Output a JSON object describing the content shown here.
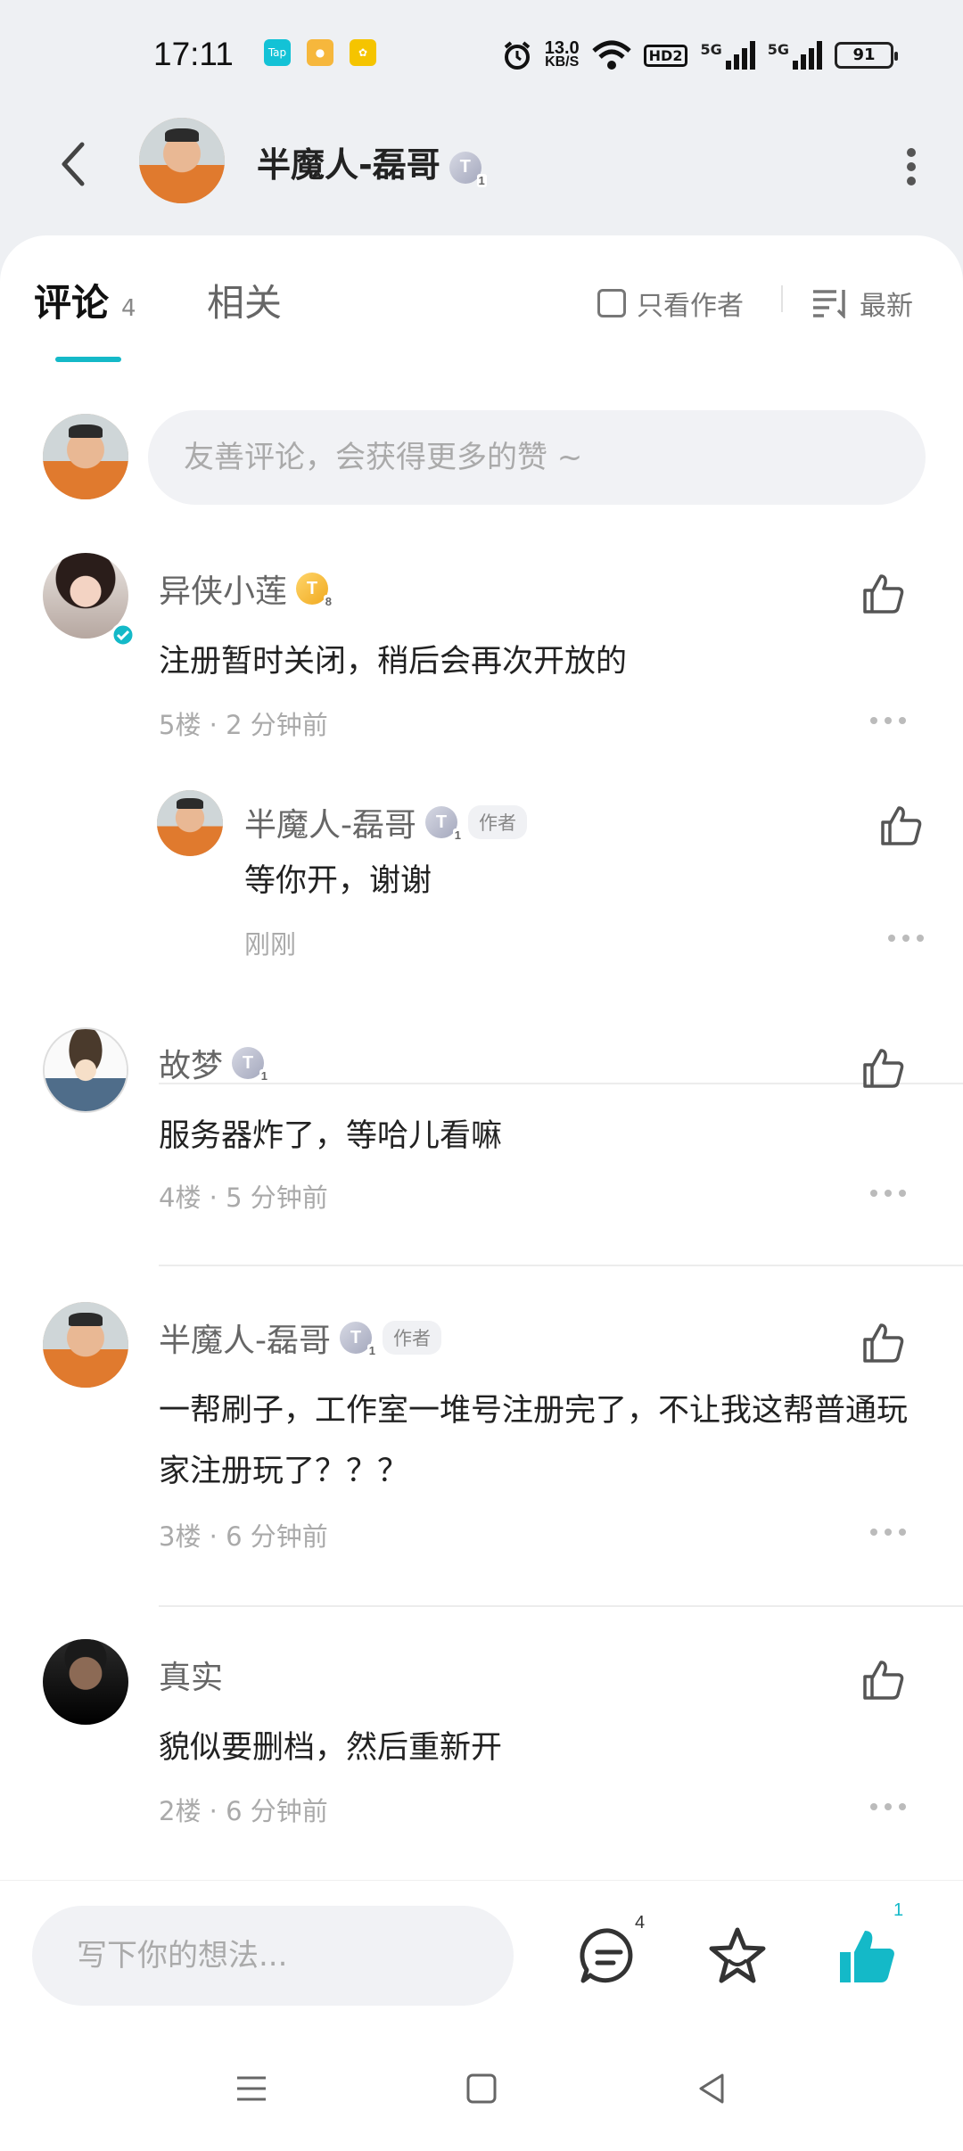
{
  "status": {
    "time": "17:11",
    "net_speed_value": "13.0",
    "net_speed_unit": "KB/S",
    "hd": "HD2",
    "sig1": "5G",
    "sig2": "5G",
    "battery": "91"
  },
  "header": {
    "name": "半魔人-磊哥",
    "badge": "T",
    "badge_level": "1"
  },
  "tabs": {
    "comment_label": "评论",
    "comment_count": "4",
    "related_label": "相关",
    "author_only": "只看作者",
    "sort": "最新"
  },
  "composer": {
    "placeholder": "友善评论，会获得更多的赞 ~"
  },
  "comments": [
    {
      "name": "异侠小莲",
      "badge": "T",
      "badge_level": "8",
      "text": "注册暂时关闭，稍后会再次开放的",
      "meta": "5楼 · 2 分钟前",
      "reply": {
        "name": "半魔人-磊哥",
        "badge": "T",
        "badge_level": "1",
        "tag": "作者",
        "text": "等你开，谢谢",
        "meta": "刚刚"
      }
    },
    {
      "name": "故梦",
      "badge": "T",
      "badge_level": "1",
      "text": "服务器炸了，等哈儿看嘛",
      "meta": "4楼 · 5 分钟前"
    },
    {
      "name": "半魔人-磊哥",
      "badge": "T",
      "badge_level": "1",
      "tag": "作者",
      "text": "一帮刷子，工作室一堆号注册完了，不让我这帮普通玩家注册玩了？？？",
      "meta": "3楼 · 6 分钟前"
    },
    {
      "name": "真实",
      "text": "貌似要删档，然后重新开",
      "meta": "2楼 · 6 分钟前"
    }
  ],
  "bottom": {
    "placeholder": "写下你的想法...",
    "comment_count": "4",
    "like_count": "1"
  },
  "colors": {
    "accent": "#14b9c8",
    "like_active": "#14b9c8"
  }
}
